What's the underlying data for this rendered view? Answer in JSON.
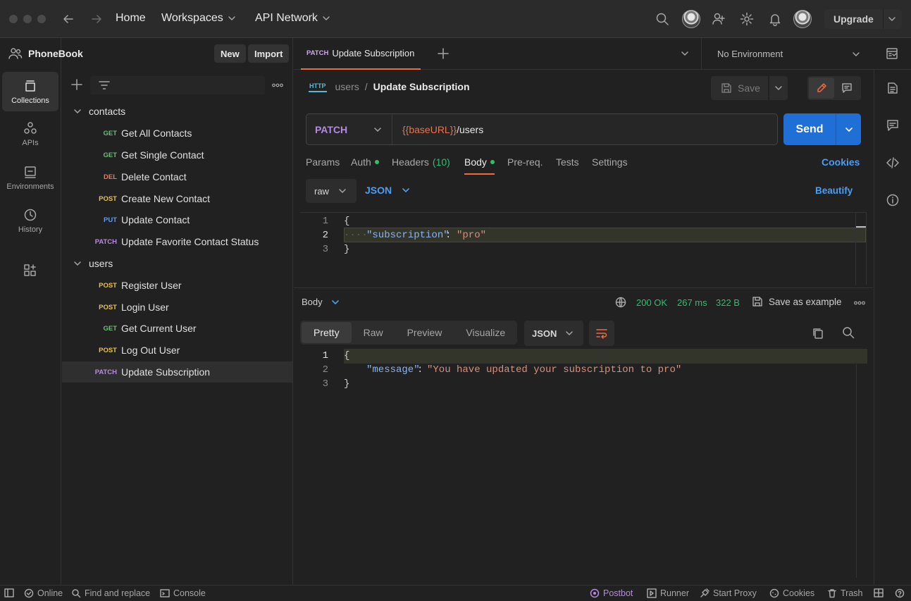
{
  "titlebar": {
    "nav": {
      "home": "Home",
      "workspaces": "Workspaces",
      "api_network": "API Network"
    },
    "upgrade": "Upgrade"
  },
  "rail": [
    {
      "label": "Collections",
      "icon": "collections-icon"
    },
    {
      "label": "APIs",
      "icon": "apis-icon"
    },
    {
      "label": "Environments",
      "icon": "environments-icon"
    },
    {
      "label": "History",
      "icon": "history-icon"
    }
  ],
  "sidebar": {
    "workspace": "PhoneBook",
    "new_label": "New",
    "import_label": "Import",
    "folders": [
      {
        "name": "contacts",
        "requests": [
          {
            "method": "GET",
            "name": "Get All Contacts"
          },
          {
            "method": "GET",
            "name": "Get Single Contact"
          },
          {
            "method": "DEL",
            "name": "Delete Contact"
          },
          {
            "method": "POST",
            "name": "Create New Contact"
          },
          {
            "method": "PUT",
            "name": "Update Contact"
          },
          {
            "method": "PATCH",
            "name": "Update Favorite Contact Status"
          }
        ]
      },
      {
        "name": "users",
        "requests": [
          {
            "method": "POST",
            "name": "Register User"
          },
          {
            "method": "POST",
            "name": "Login User"
          },
          {
            "method": "GET",
            "name": "Get Current User"
          },
          {
            "method": "POST",
            "name": "Log Out User"
          },
          {
            "method": "PATCH",
            "name": "Update Subscription"
          }
        ]
      }
    ]
  },
  "tabs": {
    "active": {
      "method": "PATCH",
      "name": "Update Subscription"
    },
    "environment": "No Environment"
  },
  "request": {
    "badge": "HTTP",
    "breadcrumb_parent": "users",
    "breadcrumb_sep": "/",
    "title": "Update Subscription",
    "save_label": "Save",
    "method": "PATCH",
    "url_var": "{{baseURL}}",
    "url_path": "/users",
    "send_label": "Send",
    "subtabs": {
      "params": "Params",
      "auth": "Auth",
      "headers": "Headers",
      "headers_count": "(10)",
      "body": "Body",
      "prereq": "Pre-req.",
      "tests": "Tests",
      "settings": "Settings"
    },
    "cookies_label": "Cookies",
    "body_mode": "raw",
    "body_lang": "JSON",
    "beautify_label": "Beautify",
    "code": {
      "l1": "1",
      "l2": "2",
      "l3": "3",
      "open": "{",
      "key": "\"subscription\"",
      "colon": ":",
      "value": "\"pro\"",
      "close": "}"
    }
  },
  "response": {
    "body_label": "Body",
    "status": "200 OK",
    "time": "267 ms",
    "size": "322 B",
    "save_example": "Save as example",
    "views": {
      "pretty": "Pretty",
      "raw": "Raw",
      "preview": "Preview",
      "visualize": "Visualize"
    },
    "format": "JSON",
    "code": {
      "l1": "1",
      "l2": "2",
      "l3": "3",
      "open": "{",
      "key": "\"message\"",
      "colon": ":",
      "value": "\"You have updated your subscription to pro\"",
      "close": "}"
    }
  },
  "statusbar": {
    "online": "Online",
    "find_replace": "Find and replace",
    "console": "Console",
    "postbot": "Postbot",
    "runner": "Runner",
    "start_proxy": "Start Proxy",
    "cookies": "Cookies",
    "trash": "Trash"
  }
}
